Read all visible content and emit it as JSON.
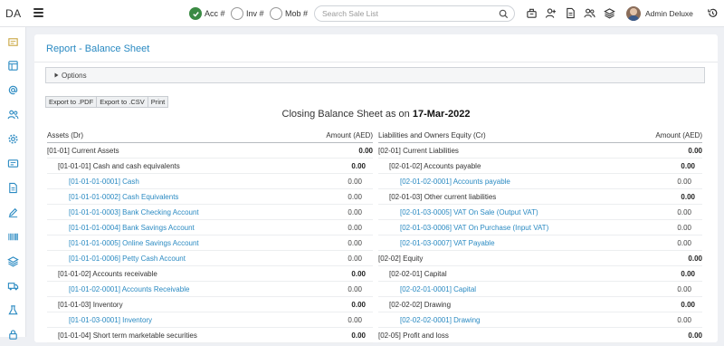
{
  "app": {
    "brand": "DA"
  },
  "topbar": {
    "radios": [
      {
        "label": "Acc #",
        "checked": true
      },
      {
        "label": "Inv #",
        "checked": false
      },
      {
        "label": "Mob #",
        "checked": false
      }
    ],
    "search": {
      "placeholder": "Search Sale List",
      "value": ""
    },
    "icons": [
      "cash-register-icon",
      "add-user-icon",
      "document-icon",
      "users-icon",
      "layers-icon"
    ],
    "user_name": "Admin Deluxe",
    "accent": "#3a8a43"
  },
  "sidebar": {
    "icons": [
      "dashboard-icon",
      "window-icon",
      "at-sign-icon",
      "users-icon",
      "settings-icon",
      "id-card-icon",
      "file-icon",
      "edit-icon",
      "barcode-icon",
      "layers-icon",
      "truck-icon",
      "flask-icon",
      "lock-icon"
    ]
  },
  "page": {
    "title": "Report - Balance Sheet",
    "options_label": "Options",
    "buttons": {
      "pdf": "Export to .PDF",
      "csv": "Export to .CSV",
      "print": "Print"
    },
    "report_title": "Closing Balance Sheet as on",
    "report_date": "17-Mar-2022",
    "link_color": "#2a8ac2"
  },
  "assets": {
    "header": {
      "name": "Assets (Dr)",
      "amount": "Amount (AED)"
    },
    "rows": [
      {
        "level": 1,
        "name": "[01-01] Current Assets",
        "amount": "0.00"
      },
      {
        "level": 2,
        "name": "[01-01-01] Cash and cash equivalents",
        "amount": "0.00"
      },
      {
        "level": 3,
        "name": "[01-01-01-0001] Cash",
        "amount": "0.00"
      },
      {
        "level": 3,
        "name": "[01-01-01-0002] Cash Equivalents",
        "amount": "0.00"
      },
      {
        "level": 3,
        "name": "[01-01-01-0003] Bank Checking Account",
        "amount": "0.00"
      },
      {
        "level": 3,
        "name": "[01-01-01-0004] Bank Savings Account",
        "amount": "0.00"
      },
      {
        "level": 3,
        "name": "[01-01-01-0005] Online Savings Account",
        "amount": "0.00"
      },
      {
        "level": 3,
        "name": "[01-01-01-0006] Petty Cash Account",
        "amount": "0.00"
      },
      {
        "level": 2,
        "name": "[01-01-02] Accounts receivable",
        "amount": "0.00"
      },
      {
        "level": 3,
        "name": "[01-01-02-0001] Accounts Receivable",
        "amount": "0.00"
      },
      {
        "level": 2,
        "name": "[01-01-03] Inventory",
        "amount": "0.00"
      },
      {
        "level": 3,
        "name": "[01-01-03-0001] Inventory",
        "amount": "0.00"
      },
      {
        "level": 2,
        "name": "[01-01-04] Short term marketable securities",
        "amount": "0.00"
      }
    ]
  },
  "liabilities": {
    "header": {
      "name": "Liabilities and Owners Equity (Cr)",
      "amount": "Amount (AED)"
    },
    "rows": [
      {
        "level": 1,
        "name": "[02-01] Current Liabilities",
        "amount": "0.00"
      },
      {
        "level": 2,
        "name": "[02-01-02] Accounts payable",
        "amount": "0.00"
      },
      {
        "level": 3,
        "name": "[02-01-02-0001] Accounts payable",
        "amount": "0.00"
      },
      {
        "level": 2,
        "name": "[02-01-03] Other current liabilities",
        "amount": "0.00"
      },
      {
        "level": 3,
        "name": "[02-01-03-0005] VAT On Sale (Output VAT)",
        "amount": "0.00"
      },
      {
        "level": 3,
        "name": "[02-01-03-0006] VAT On Purchase (Input VAT)",
        "amount": "0.00"
      },
      {
        "level": 3,
        "name": "[02-01-03-0007] VAT Payable",
        "amount": "0.00"
      },
      {
        "level": 1,
        "name": "[02-02] Equity",
        "amount": "0.00"
      },
      {
        "level": 2,
        "name": "[02-02-01] Capital",
        "amount": "0.00"
      },
      {
        "level": 3,
        "name": "[02-02-01-0001] Capital",
        "amount": "0.00"
      },
      {
        "level": 2,
        "name": "[02-02-02] Drawing",
        "amount": "0.00"
      },
      {
        "level": 3,
        "name": "[02-02-02-0001] Drawing",
        "amount": "0.00"
      },
      {
        "level": 1,
        "name": "[02-05] Profit and loss",
        "amount": "0.00"
      }
    ]
  }
}
